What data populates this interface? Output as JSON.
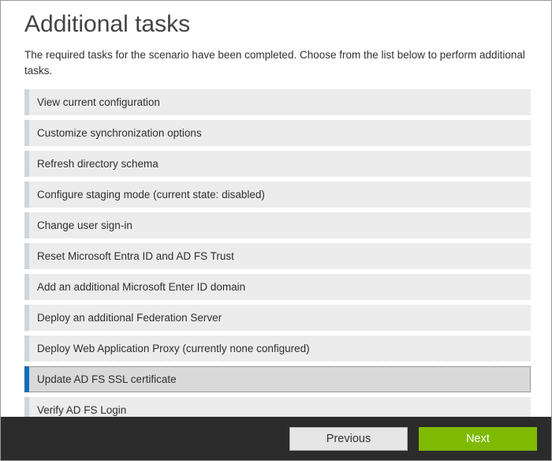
{
  "header": {
    "title": "Additional tasks",
    "description": "The required tasks for the scenario have been completed. Choose from the list below to perform additional tasks."
  },
  "tasks": [
    {
      "label": "View current configuration",
      "selected": false
    },
    {
      "label": "Customize synchronization options",
      "selected": false
    },
    {
      "label": "Refresh directory schema",
      "selected": false
    },
    {
      "label": "Configure staging mode (current state: disabled)",
      "selected": false
    },
    {
      "label": "Change user sign-in",
      "selected": false
    },
    {
      "label": "Reset Microsoft Entra ID and AD FS Trust",
      "selected": false
    },
    {
      "label": "Add an additional Microsoft Enter ID domain",
      "selected": false
    },
    {
      "label": "Deploy an additional Federation Server",
      "selected": false
    },
    {
      "label": "Deploy Web Application Proxy (currently none configured)",
      "selected": false
    },
    {
      "label": "Update AD FS SSL certificate",
      "selected": true
    },
    {
      "label": "Verify AD FS Login",
      "selected": false
    }
  ],
  "footer": {
    "previous_label": "Previous",
    "next_label": "Next"
  }
}
